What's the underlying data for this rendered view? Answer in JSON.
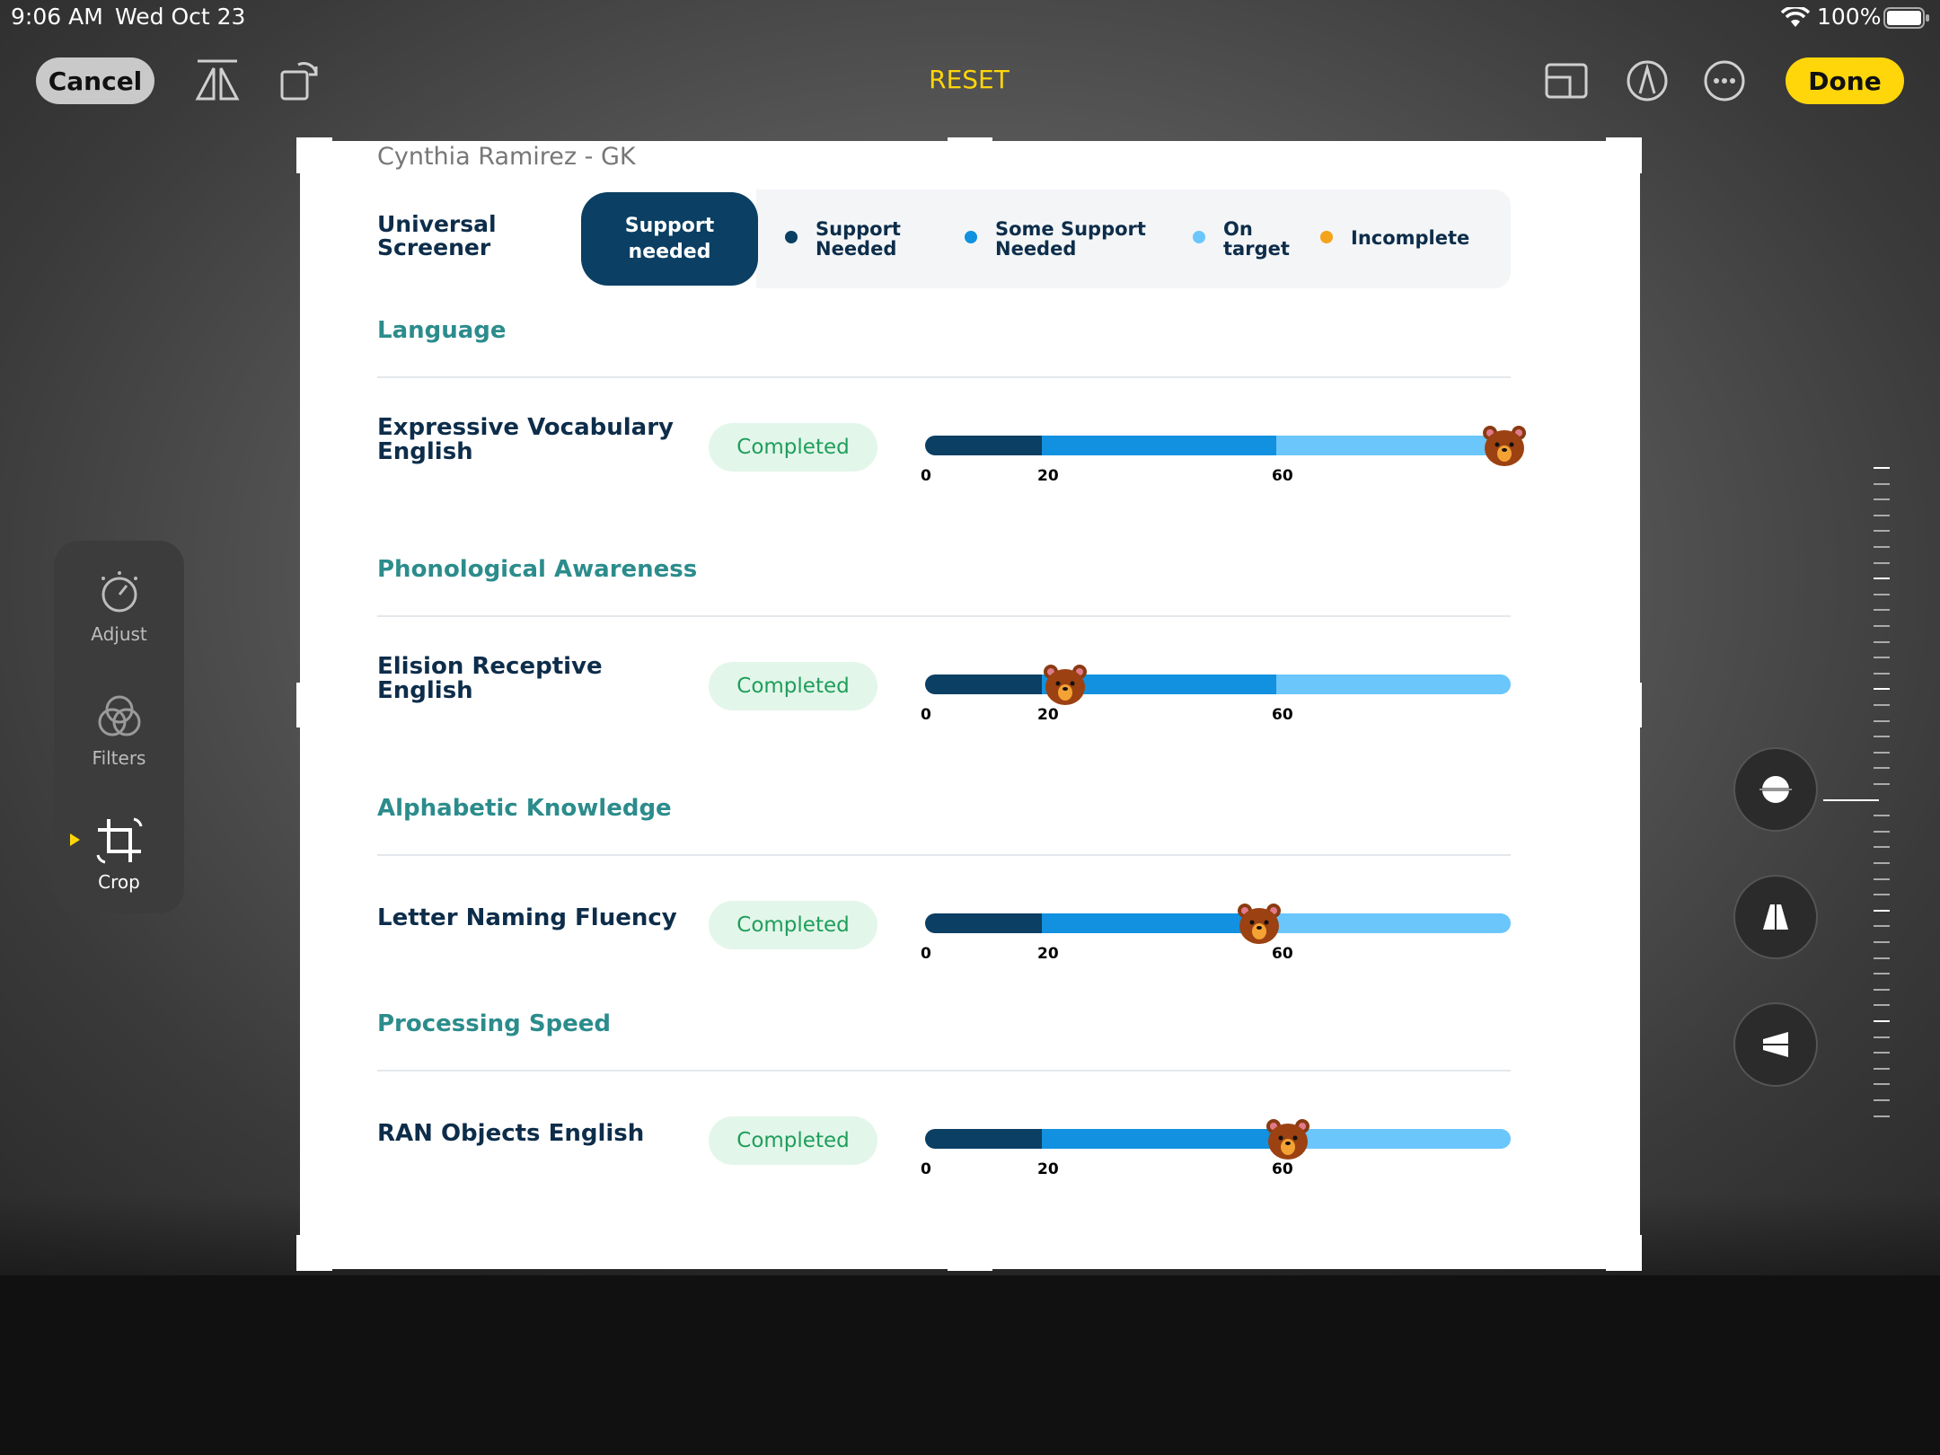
{
  "status_bar": {
    "time": "9:06 AM",
    "date": "Wed Oct 23",
    "battery": "100%"
  },
  "toolbar": {
    "cancel_label": "Cancel",
    "reset_label": "RESET",
    "done_label": "Done"
  },
  "tools": [
    {
      "label": "Adjust",
      "icon": "adjust-dial-icon"
    },
    {
      "label": "Filters",
      "icon": "filters-circles-icon"
    },
    {
      "label": "Crop",
      "icon": "crop-rotate-icon",
      "selected": true
    }
  ],
  "colors": {
    "accent": "#ffd60a",
    "support_needed": "#0b3f63",
    "some_support": "#1191e0",
    "on_target": "#6ac6fb",
    "incomplete": "#f5a31a",
    "section_heading": "#2c8c8c",
    "completed_text": "#1e9e5a"
  },
  "screen": {
    "student": "Cynthia Ramirez - GK",
    "screener_title": "Universal Screener",
    "support_pill": "Support needed",
    "legend": [
      {
        "label": "Support Needed",
        "color": "#0b3f63"
      },
      {
        "label": "Some Support Needed",
        "color": "#1191e0"
      },
      {
        "label": "On target",
        "color": "#6ac6fb"
      },
      {
        "label": "Incomplete",
        "color": "#f5a31a"
      }
    ],
    "sections": [
      {
        "heading": "Language",
        "assessment": "Expressive Vocabulary English",
        "status": "Completed",
        "score_fraction": 0.99,
        "ticks": [
          "0",
          "20",
          "60"
        ]
      },
      {
        "heading": "Phonological Awareness",
        "assessment": "Elision Receptive English",
        "status": "Completed",
        "score_fraction": 0.24,
        "ticks": [
          "0",
          "20",
          "60"
        ]
      },
      {
        "heading": "Alphabetic Knowledge",
        "assessment": "Letter Naming Fluency",
        "status": "Completed",
        "score_fraction": 0.57,
        "ticks": [
          "0",
          "20",
          "60"
        ]
      },
      {
        "heading": "Processing Speed",
        "assessment": "RAN Objects English",
        "status": "Completed",
        "score_fraction": 0.62,
        "ticks": [
          "0",
          "20",
          "60"
        ]
      }
    ]
  }
}
